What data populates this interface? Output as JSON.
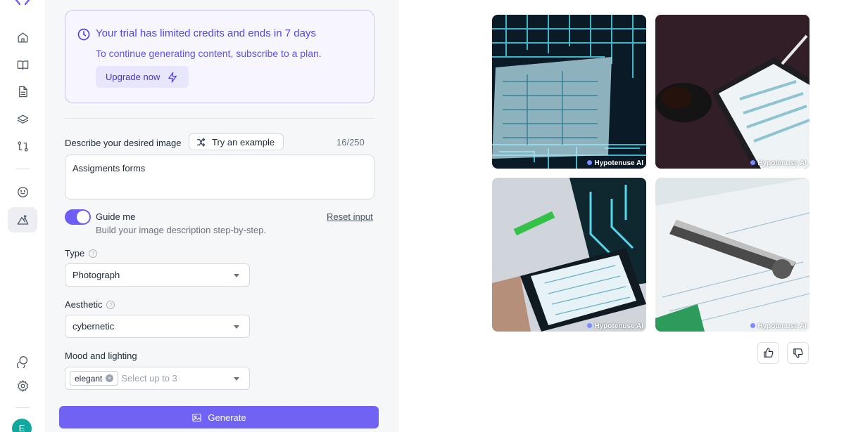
{
  "colors": {
    "accent": "#6d5ef5",
    "trial_text": "#4f46e5",
    "panel_bg": "#f6f7f9",
    "avatar": "#13a89e"
  },
  "sidebar": {
    "icons": [
      "home-icon",
      "book-icon",
      "document-icon",
      "layers-icon",
      "workflow-icon",
      "chat-bot-icon",
      "image-generator-icon",
      "integrations-icon",
      "settings-icon"
    ],
    "avatar_initial": "E"
  },
  "trial": {
    "title": "Your trial has limited credits and ends in 7 days",
    "subtitle": "To continue generating content, subscribe to a plan.",
    "upgrade_label": "Upgrade now"
  },
  "prompt": {
    "label": "Describe your desired image",
    "try_example_label": "Try an example",
    "counter": "16/250",
    "value": "Assigments forms"
  },
  "guide": {
    "enabled": true,
    "title": "Guide me",
    "subtitle": "Build your image description step-by-step.",
    "reset_label": "Reset input"
  },
  "type": {
    "label": "Type",
    "value": "Photograph"
  },
  "aesthetic": {
    "label": "Aesthetic",
    "value": "cybernetic"
  },
  "mood": {
    "label": "Mood and lighting",
    "chip": "elegant",
    "placeholder": "Select up to 3"
  },
  "generate_label": "Generate",
  "images": [
    {
      "watermark": "Hypotenuse AI"
    },
    {
      "watermark": "Hypotenuse AI"
    },
    {
      "watermark": "Hypotenuse AI"
    },
    {
      "watermark": "Hypotenuse AI"
    }
  ]
}
